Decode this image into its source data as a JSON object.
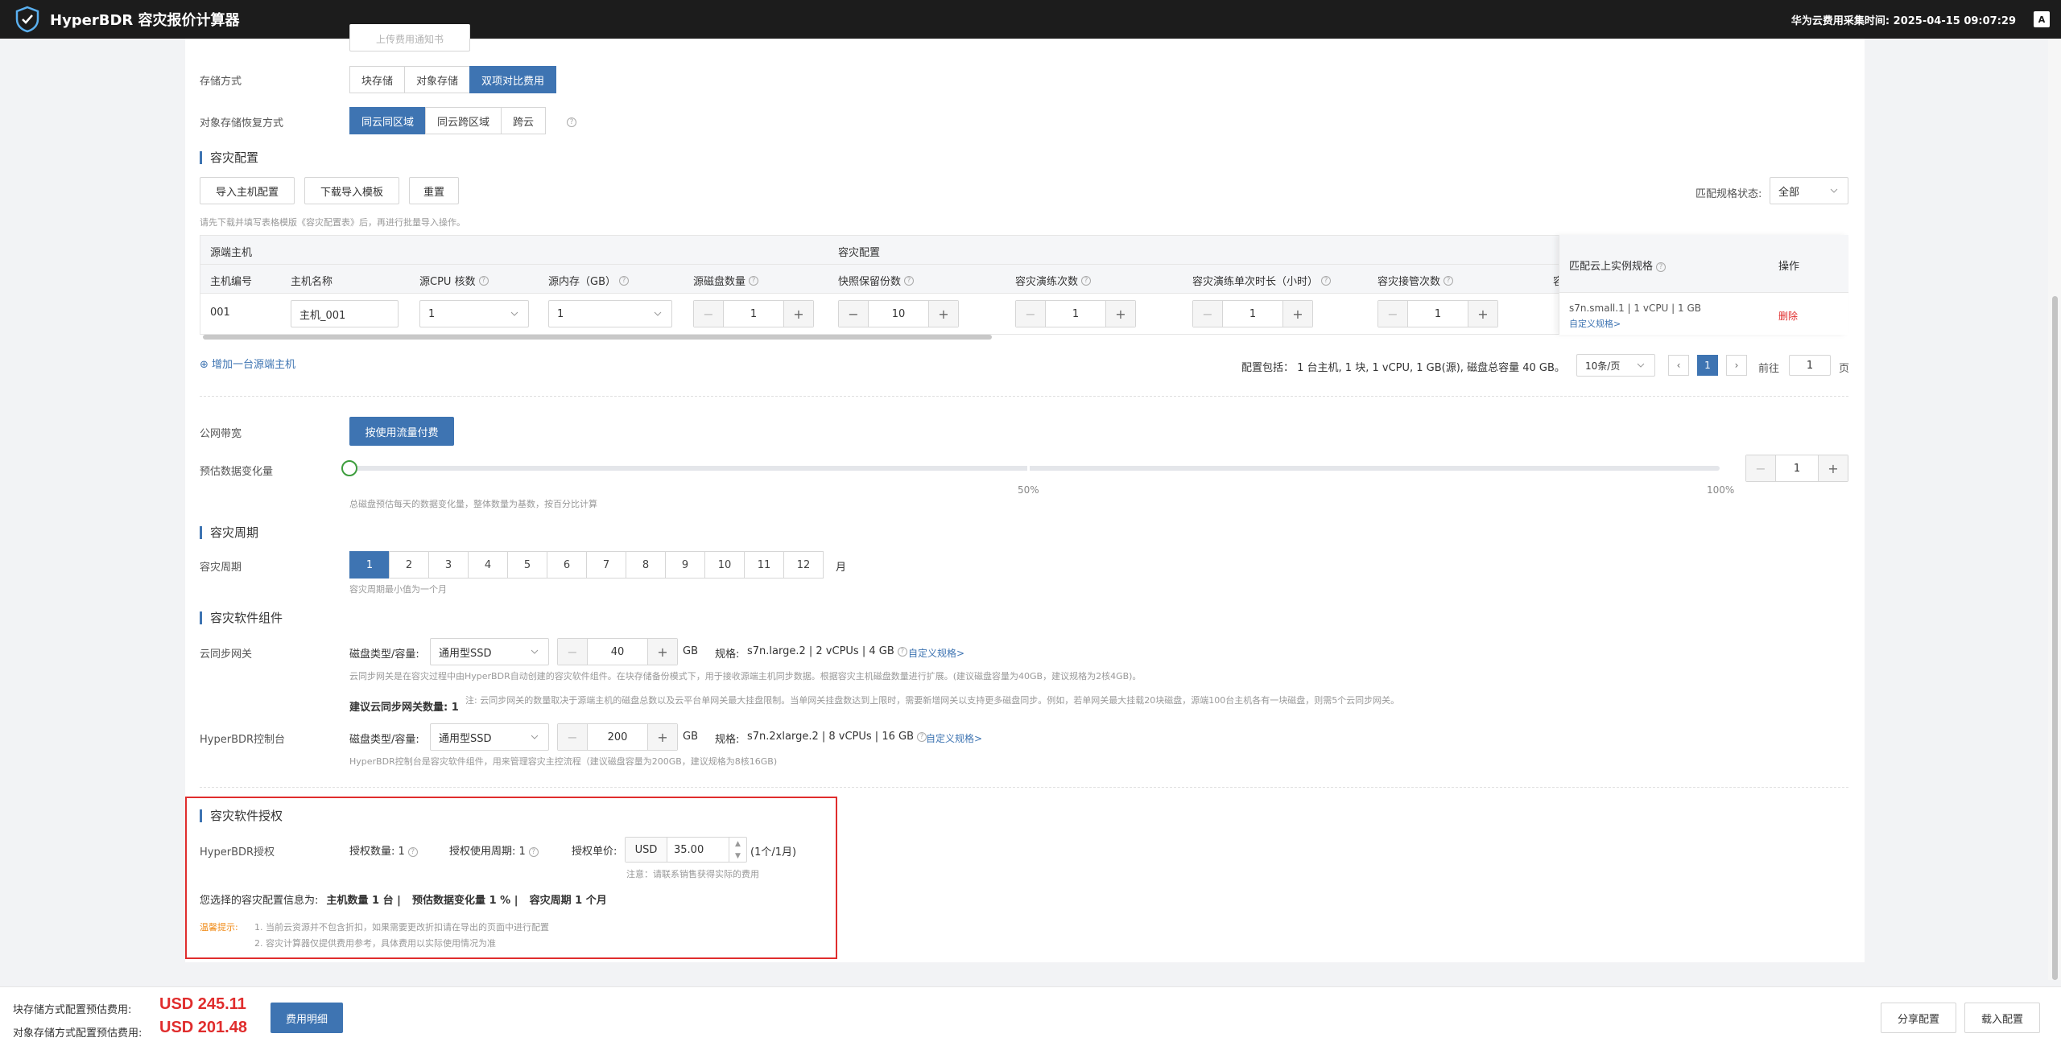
{
  "header": {
    "title": "HyperBDR 容灾报价计算器",
    "collect_time": "华为云费用采集时间: 2025-04-15 09:07:29",
    "lang_icon": "A"
  },
  "top_partial_button": "上传费用通知书",
  "storage": {
    "label": "存储方式",
    "options": [
      "块存储",
      "对象存储",
      "双项对比费用"
    ],
    "active": 2
  },
  "object_recovery": {
    "label": "对象存储恢复方式",
    "options": [
      "同云同区域",
      "同云跨区域",
      "跨云"
    ],
    "active": 0
  },
  "dr_config": {
    "title": "容灾配置",
    "buttons": {
      "import": "导入主机配置",
      "download": "下载导入模板",
      "reset": "重置"
    },
    "hint": "请先下载并填写表格模版《容灾配置表》后，再进行批量导入操作。",
    "match_label": "匹配规格状态:",
    "match_value": "全部",
    "group_headers": {
      "source": "源端主机",
      "dr": "容灾配置"
    },
    "columns": {
      "host_id": "主机编号",
      "host_name": "主机名称",
      "cpu": "源CPU 核数",
      "mem": "源内存（GB）",
      "disks": "源磁盘数量",
      "snapshots": "快照保留份数",
      "drill_count": "容灾演练次数",
      "drill_hours": "容灾演练单次时长（小时）",
      "takeover": "容灾接管次数",
      "cut": "容",
      "match_spec": "匹配云上实例规格",
      "ops": "操作"
    },
    "row": {
      "host_id": "001",
      "host_name": "主机_001",
      "cpu": "1",
      "mem": "1",
      "disks": "1",
      "snapshots": "10",
      "drill_count": "1",
      "drill_hours": "1",
      "takeover": "1",
      "spec": "s7n.small.1 | 1 vCPU | 1 GB",
      "custom_spec": "自定义规格>",
      "delete": "删除"
    },
    "add_host": "增加一台源端主机",
    "summary": "配置包括： 1 台主机, 1 块, 1 vCPU, 1 GB(源), 磁盘总容量 40 GB。",
    "pagination": {
      "page_size": "10条/页",
      "current": "1",
      "goto_label": "前往",
      "goto_value": "1",
      "page_unit": "页"
    }
  },
  "bandwidth": {
    "label": "公网带宽",
    "button": "按使用流量付费"
  },
  "change_rate": {
    "label": "预估数据变化量",
    "value": 1,
    "value_text": "1",
    "mid_label": "50%",
    "max_label": "100%",
    "hint": "总磁盘预估每天的数据变化量，整体数量为基数，按百分比计算"
  },
  "period": {
    "title": "容灾周期",
    "label": "容灾周期",
    "options": [
      "1",
      "2",
      "3",
      "4",
      "5",
      "6",
      "7",
      "8",
      "9",
      "10",
      "11",
      "12"
    ],
    "active": 0,
    "unit": "月",
    "hint": "容灾周期最小值为一个月"
  },
  "components": {
    "title": "容灾软件组件",
    "gateway": {
      "label": "云同步网关",
      "disk_label": "磁盘类型/容量:",
      "disk_type": "通用型SSD",
      "size": "40",
      "unit": "GB",
      "spec_label": "规格:",
      "spec": "s7n.large.2 | 2 vCPUs | 4 GB",
      "custom": "自定义规格>",
      "desc": "云同步网关是在容灾过程中由HyperBDR自动创建的容灾软件组件。在块存储备份模式下，用于接收源端主机同步数据。根据容灾主机磁盘数量进行扩展。(建议磁盘容量为40GB，建议规格为2核4GB)。",
      "count_label": "建议云同步网关数量: 1",
      "note": "注: 云同步网关的数量取决于源端主机的磁盘总数以及云平台单网关最大挂盘限制。当单网关挂盘数达到上限时，需要新增网关以支持更多磁盘同步。例如，若单网关最大挂载20块磁盘，源端100台主机各有一块磁盘，则需5个云同步网关。"
    },
    "console": {
      "label": "HyperBDR控制台",
      "disk_label": "磁盘类型/容量:",
      "disk_type": "通用型SSD",
      "size": "200",
      "unit": "GB",
      "spec_label": "规格:",
      "spec": "s7n.2xlarge.2 | 8 vCPUs | 16 GB",
      "custom": "自定义规格>",
      "desc": "HyperBDR控制台是容灾软件组件，用来管理容灾主控流程（建议磁盘容量为200GB，建议规格为8核16GB)"
    }
  },
  "license": {
    "title": "容灾软件授权",
    "label": "HyperBDR授权",
    "count": "授权数量: 1",
    "period": "授权使用周期: 1",
    "price_label": "授权单价:",
    "currency": "USD",
    "price": "35.00",
    "unit": "(1个/1月)",
    "note": "注意：请联系销售获得实际的费用",
    "summary_label": "您选择的容灾配置信息为:",
    "summary_items": [
      "主机数量 1 台 |",
      "预估数据变化量 1 % |",
      "容灾周期 1 个月"
    ],
    "tip_label": "温馨提示:",
    "tips": [
      "1. 当前云资源并不包含折扣，如果需要更改折扣请在导出的页面中进行配置",
      "2. 容灾计算器仅提供费用参考，具体费用以实际使用情况为准"
    ]
  },
  "footer": {
    "block_label": "块存储方式配置预估费用:",
    "block_price": "USD 245.11",
    "object_label": "对象存储方式配置预估费用:",
    "object_price": "USD 201.48",
    "detail_button": "费用明细",
    "share_button": "分享配置",
    "load_button": "载入配置"
  },
  "colors": {
    "accent": "#3e74b2",
    "price": "#e02d2d",
    "highlight_border": "#e02d2d"
  }
}
